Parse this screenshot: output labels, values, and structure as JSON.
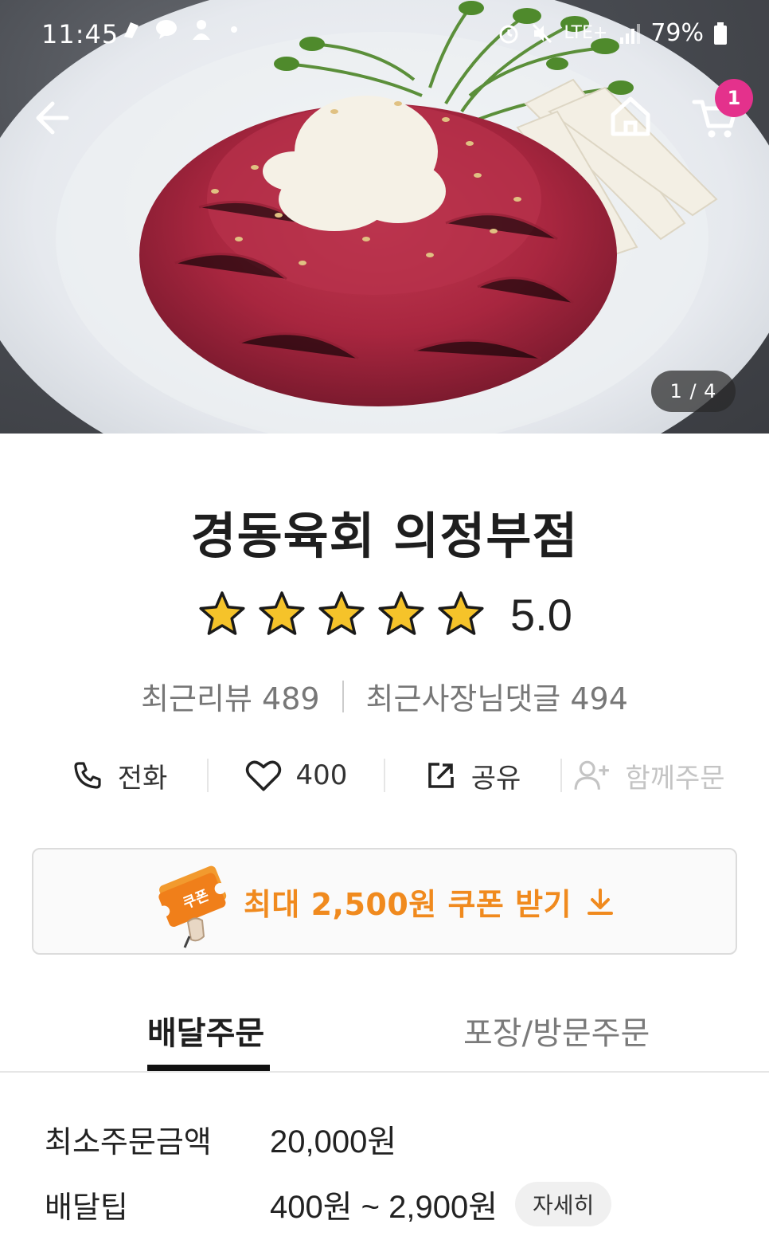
{
  "status_bar": {
    "time": "11:45",
    "battery": "79%",
    "network": "LTE+"
  },
  "hero": {
    "page_indicator": "1 / 4",
    "cart_count": "1"
  },
  "store": {
    "name": "경동육회 의정부점",
    "rating": "5.0",
    "stars_filled": 5,
    "stars_total": 5,
    "recent_reviews_label": "최근리뷰 489",
    "recent_owner_replies_label": "최근사장님댓글 494"
  },
  "actions": {
    "call_label": "전화",
    "like_count": "400",
    "share_label": "공유",
    "group_order_label": "함께주문"
  },
  "coupon": {
    "icon_text": "쿠폰",
    "label": "최대 2,500원 쿠폰 받기"
  },
  "tabs": {
    "delivery": "배달주문",
    "pickup": "포장/방문주문"
  },
  "info": {
    "min_order_label": "최소주문금액",
    "min_order_value": "20,000원",
    "delivery_tip_label": "배달팁",
    "delivery_tip_value": "400원 ~ 2,900원",
    "detail_button": "자세히"
  },
  "colors": {
    "accent_orange": "#f08a1e",
    "badge_pink": "#e4318c",
    "star_gold": "#f5c32a"
  }
}
